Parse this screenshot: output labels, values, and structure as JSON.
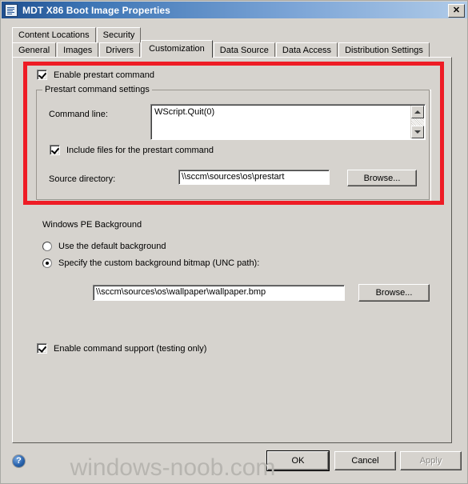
{
  "window": {
    "title": "MDT X86 Boot Image Properties",
    "icon": "properties-document-icon",
    "close_label": "✕"
  },
  "tabs": {
    "row1": [
      {
        "label": "Content Locations",
        "selected": false
      },
      {
        "label": "Security",
        "selected": false
      }
    ],
    "row2": [
      {
        "label": "General",
        "selected": false
      },
      {
        "label": "Images",
        "selected": false
      },
      {
        "label": "Drivers",
        "selected": false
      },
      {
        "label": "Customization",
        "selected": true
      },
      {
        "label": "Data Source",
        "selected": false
      },
      {
        "label": "Data Access",
        "selected": false
      },
      {
        "label": "Distribution Settings",
        "selected": false
      }
    ]
  },
  "customization": {
    "enable_prestart": {
      "label": "Enable prestart command",
      "checked": true
    },
    "prestart_group": {
      "legend": "Prestart command settings",
      "command_line_label": "Command line:",
      "command_line_value": "WScript.Quit(0)",
      "include_files": {
        "label": "Include files for the prestart command",
        "checked": true
      },
      "source_directory_label": "Source directory:",
      "source_directory_value": "\\\\sccm\\sources\\os\\prestart",
      "browse_label": "Browse..."
    },
    "winpe_background": {
      "heading": "Windows PE Background",
      "option_default": {
        "label": "Use the default background",
        "selected": false
      },
      "option_custom": {
        "label": "Specify the custom background bitmap (UNC path):",
        "selected": true
      },
      "bitmap_path_value": "\\\\sccm\\sources\\os\\wallpaper\\wallpaper.bmp",
      "browse_label": "Browse..."
    },
    "enable_command_support": {
      "label": "Enable command support (testing only)",
      "checked": true
    }
  },
  "footer": {
    "help_label": "?",
    "ok_label": "OK",
    "cancel_label": "Cancel",
    "apply_label": "Apply",
    "apply_enabled": false
  },
  "watermark": {
    "text": "windows-noob.com"
  },
  "colors": {
    "titlebar_start": "#1f4f8f",
    "titlebar_end": "#b0cbe8",
    "dialog_face": "#d6d3ce",
    "highlight_red": "#ee1c25",
    "watermark_grey": "#b7b5b0"
  }
}
